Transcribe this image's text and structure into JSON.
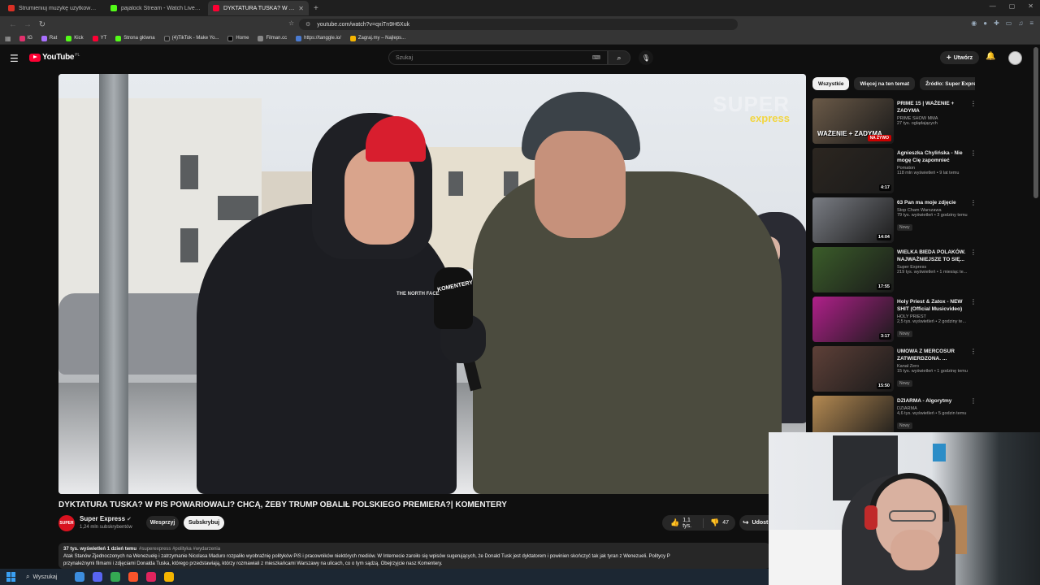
{
  "browser": {
    "tabs": [
      {
        "title": "Strumieniuj muzykę użytkownika jnc...",
        "color": "#d93025"
      },
      {
        "title": "pajalock Stream - Watch Live on Kick",
        "color": "#53fc18"
      },
      {
        "title": "DYKTATURA TUSKA? W PIS P...",
        "color": "#ff0033"
      }
    ],
    "url": "youtube.com/watch?v=qxiTn9H6Xuk",
    "bookmarks": [
      "IG",
      "Rat",
      "Kick",
      "YT",
      "Strona główna",
      "(4)TikTok - Make Yo...",
      "Home",
      "Filman.cc",
      "https://tanggle.io/",
      "Zagraj.my – Najleps..."
    ]
  },
  "youtube": {
    "logo_text": "YouTube",
    "country": "PL",
    "search_placeholder": "Szukaj",
    "create_label": "Utwórz"
  },
  "video": {
    "watermark_top": "SUPER",
    "watermark_bottom": "express",
    "mic_brand": "KOMENTERY",
    "jacket_brand": "THE NORTH FACE",
    "title": "DYKTATURA TUSKA? W PIS POWARIOWALI? CHCĄ, ŻEBY TRUMP OBALIŁ POLSKIEGO PREMIERA?| KOMENTERY",
    "channel_avatar_text": "SUPER",
    "channel": "Super Express",
    "subscribers": "1,24 mln subskrybentów",
    "support_label": "Wesprzyj",
    "subscribe_label": "Subskrybuj",
    "likes": "1,1 tys.",
    "dislikes": "47",
    "share_label": "Udost",
    "stats": "37 tys. wyświetleń  1 dzień temu",
    "tags": "#superexpress #polityka #wydarzenia",
    "desc_line1": "Atak Stanów Zjednoczonych na Wenezuelę i zatrzymanie Nicolasa Maduro rozpaliło wyobraźnię polityków PiS i pracowników niektórych mediów. W Internecie zaroiło się wpisów sugerujących, że Donald Tusk jest dyktatorem i powinien skończyć tak jak tyran z Wenezueli.  Politycy P",
    "desc_line2": "przynależnymi filmami i zdjęciami Donalda Tuska, którego przedstawiają, którzy rozmawiali z mieszkańcami Warszawy na ulicach, co o tym sądzą. Obejrzyjcie nasz Komentery."
  },
  "sidebar": {
    "chips": [
      "Wszystkie",
      "Więcej na ten temat",
      "Źródło: Super Express"
    ],
    "recommendations": [
      {
        "title": "PRIME 15 | WAŻENIE + ZADYMA",
        "channel": "PRIME SHOW MMA",
        "views": "27 tys. oglądających",
        "thumb_text": "WAŻENIE + ZADYMA",
        "duration": "",
        "live": "NA ŻYWO",
        "badge": "",
        "color": "#6b5a48"
      },
      {
        "title": "Agnieszka Chylińska - Nie mogę Cię zapomnieć",
        "channel": "Pomaton",
        "views": "118 mln wyświetleń • 9 lat temu",
        "thumb_text": "",
        "duration": "4:17",
        "live": "",
        "badge": "",
        "color": "#2c2620"
      },
      {
        "title": "63 Pan ma moje zdjęcie",
        "channel": "Stop Cham Warszawa",
        "views": "79 tys. wyświetleń • 3 godziny temu",
        "thumb_text": "",
        "duration": "14:04",
        "live": "",
        "badge": "Nowy",
        "color": "#7a7d84"
      },
      {
        "title": "WIELKA BIEDA POLAKÓW. NAJWAŻNIEJSZE TO SIĘ...",
        "channel": "Super Express",
        "views": "219 tys. wyświetleń • 1 miesiąc te...",
        "thumb_text": "",
        "duration": "17:55",
        "live": "",
        "badge": "",
        "color": "#3b5d2a"
      },
      {
        "title": "Holy Priest & Zatox - NEW SHIT (Official Musicvideo)",
        "channel": "HOLY PRIEST",
        "views": "2,5 tys. wyświetleń • 2 godziny te...",
        "thumb_text": "",
        "duration": "3:17",
        "live": "",
        "badge": "Nowy",
        "color": "#b0208a"
      },
      {
        "title": "UMOWA Z MERCOSUR ZATWIERDZONA. ...",
        "channel": "Kanał Zero",
        "views": "15 tys. wyświetleń • 1 godzinę temu",
        "thumb_text": "",
        "duration": "15:50",
        "live": "",
        "badge": "Nowy",
        "color": "#5e4038"
      },
      {
        "title": "DZIARMA - Algorytmy",
        "channel": "DZIARMA",
        "views": "4,6 tys. wyświetleń • 5 godzin temu",
        "thumb_text": "",
        "duration": "2:43",
        "live": "",
        "badge": "Nowy",
        "color": "#b58a52"
      }
    ]
  },
  "taskbar": {
    "search_label": "Wyszukaj",
    "apps": [
      "#3c8dde",
      "#5865f2",
      "#34a853",
      "#fb542b",
      "#e0245e",
      "#f4b400"
    ]
  }
}
